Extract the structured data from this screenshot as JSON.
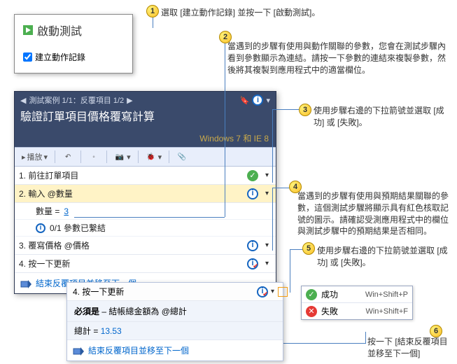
{
  "callouts": {
    "c1": "選取 [建立動作記錄] 並按一下 [啟動測試]。",
    "c2": "當遇到的步驟有使用與動作關聯的參數，您會在測試步驟內看到參數顯示為連結。請按一下參數的連結來複製參數，然後將其複製到應用程式中的適當欄位。",
    "c3": "使用步驟右邊的下拉箭號並選取 [成功] 或 [失敗]。",
    "c4": "當遇到的步驟有使用與預期結果關聯的參數，這個測試步驟將顯示具有紅色核取記號的圖示。請確認受測應用程式中的欄位與測試步驟中的預期結果是否相同。",
    "c5": "使用步驟右邊的下拉箭號並選取 [成功] 或 [失敗]。",
    "c6": "按一下 [結束反覆項目並移至下一個]"
  },
  "popup": {
    "title": "啟動測試",
    "checkbox": "建立動作記錄"
  },
  "panel": {
    "path_a": "測試案例 1/1：反覆項目 1/2",
    "title": "驗證訂單項目價格覆寫計算",
    "env": "Windows 7 和 IE 8",
    "play": "播放"
  },
  "steps": {
    "s1": "1. 前往訂單項目",
    "s2": "2. 輸入 @數量",
    "s2_sub_a_label": "數量 = ",
    "s2_sub_a_value": "3",
    "s2_sub_b": "0/1 參數已繫結",
    "s3": "3. 覆寫價格 @價格",
    "s4": "4. 按一下更新",
    "end_link": "結束反覆項目並移至下一個"
  },
  "detail": {
    "head": "4. 按一下更新",
    "must": "必須是",
    "body": " – 結帳總金額為 @總計",
    "total_label": "總計 = ",
    "total_value": "13.53",
    "end_link": "結束反覆項目並移至下一個"
  },
  "passfail": {
    "pass": "成功",
    "pass_key": "Win+Shift+P",
    "fail": "失敗",
    "fail_key": "Win+Shift+F"
  }
}
